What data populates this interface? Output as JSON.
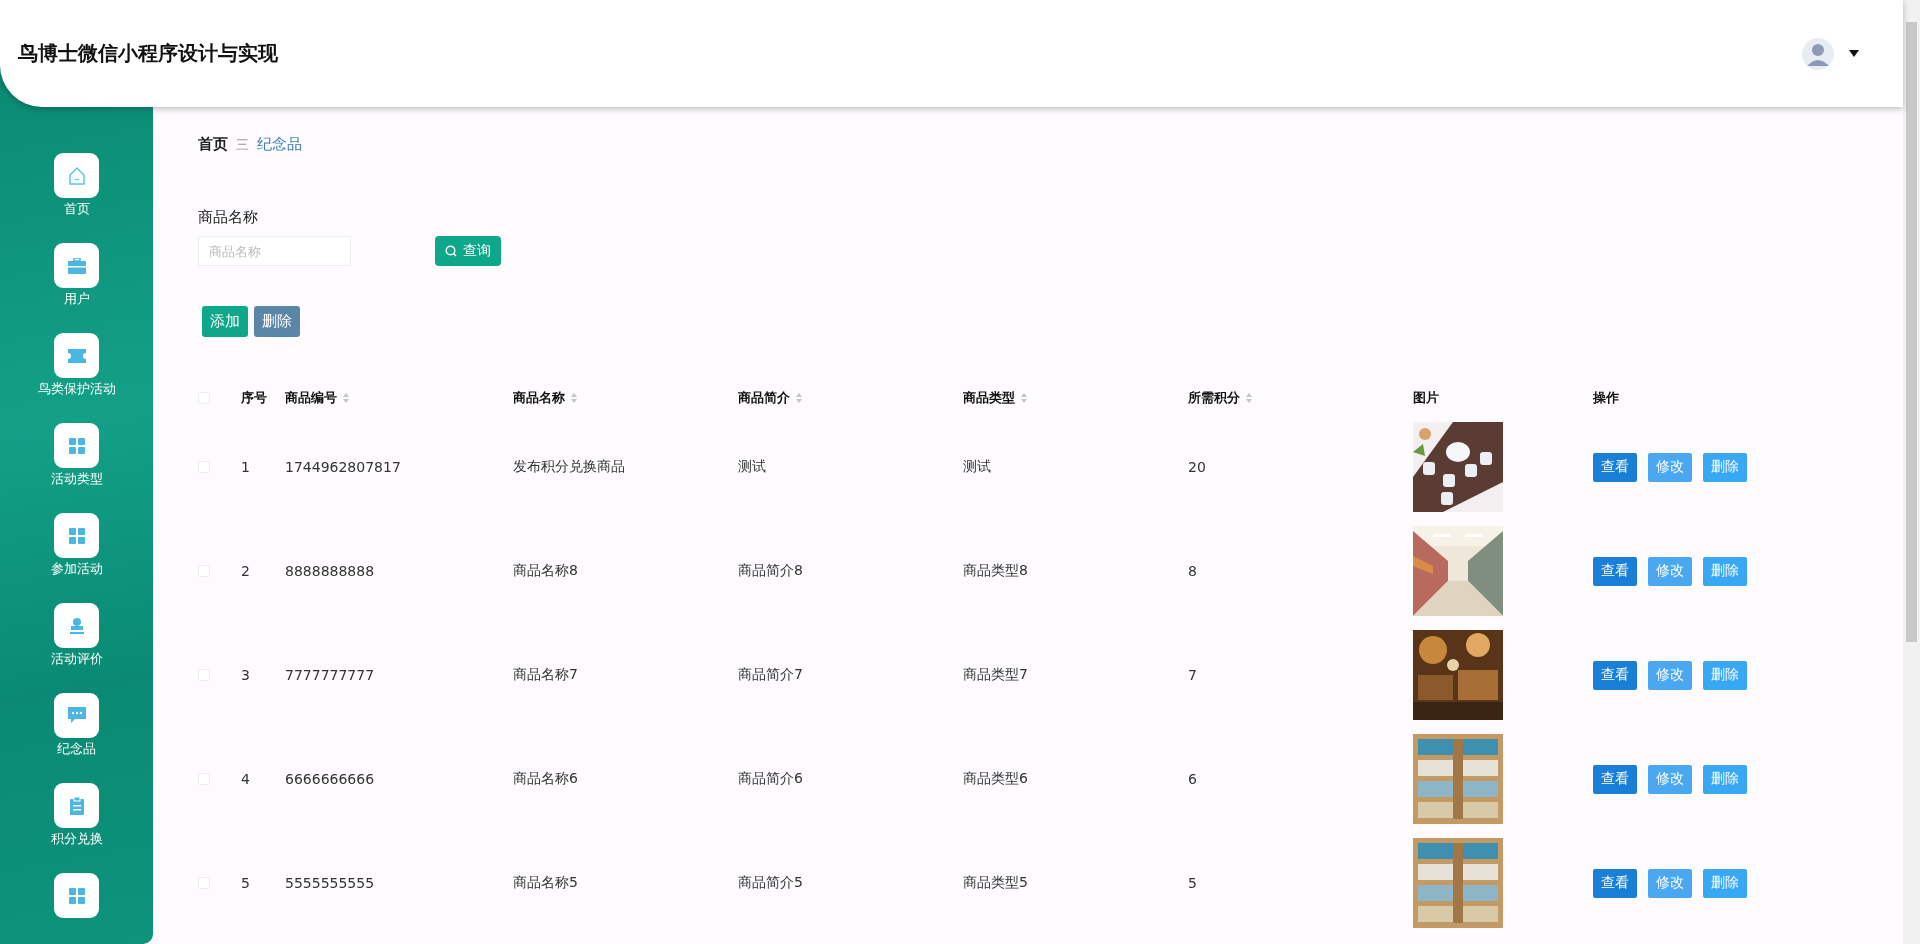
{
  "header": {
    "title": "鸟博士微信小程序设计与实现"
  },
  "sidebar": {
    "items": [
      {
        "label": "首页",
        "kind": "home"
      },
      {
        "label": "用户",
        "kind": "briefcase"
      },
      {
        "label": "鸟类保护活动",
        "kind": "ticket"
      },
      {
        "label": "活动类型",
        "kind": "grid"
      },
      {
        "label": "参加活动",
        "kind": "grid"
      },
      {
        "label": "活动评价",
        "kind": "stamp"
      },
      {
        "label": "纪念品",
        "kind": "chat"
      },
      {
        "label": "积分兑换",
        "kind": "clipboard"
      },
      {
        "kind": "grid"
      }
    ]
  },
  "breadcrumb": {
    "items": [
      "首页",
      "纪念品"
    ],
    "separator": "三"
  },
  "search": {
    "label": "商品名称",
    "placeholder": "商品名称",
    "button": "查询"
  },
  "actions": [
    {
      "label": "添加",
      "kind": "add"
    },
    {
      "label": "删除",
      "kind": "delete"
    }
  ],
  "table": {
    "header_checked": false,
    "columns": [
      {
        "label": "序号",
        "sortable": false
      },
      {
        "label": "商品编号",
        "sortable": true
      },
      {
        "label": "商品名称",
        "sortable": true
      },
      {
        "label": "商品简介",
        "sortable": true
      },
      {
        "label": "商品类型",
        "sortable": true
      },
      {
        "label": "所需积分",
        "sortable": true
      },
      {
        "label": "图片",
        "sortable": false
      },
      {
        "label": "操作",
        "sortable": false
      }
    ],
    "rows": [
      {
        "checked": false,
        "cells": [
          "1",
          "1744962807817",
          "发布积分兑换商品",
          "测试",
          "测试",
          "20"
        ],
        "kind": "picture",
        "buttons": [
          {
            "label": "查看",
            "kind": "view"
          },
          {
            "label": "修改",
            "kind": "edit"
          },
          {
            "label": "删除",
            "kind": "delete"
          }
        ]
      },
      {
        "checked": false,
        "cells": [
          "2",
          "8888888888",
          "商品名称8",
          "商品简介8",
          "商品类型8",
          "8"
        ],
        "kind": "picture",
        "buttons": [
          {
            "label": "查看",
            "kind": "view"
          },
          {
            "label": "修改",
            "kind": "edit"
          },
          {
            "label": "删除",
            "kind": "delete"
          }
        ]
      },
      {
        "checked": false,
        "cells": [
          "3",
          "7777777777",
          "商品名称7",
          "商品简介7",
          "商品类型7",
          "7"
        ],
        "kind": "picture",
        "buttons": [
          {
            "label": "查看",
            "kind": "view"
          },
          {
            "label": "修改",
            "kind": "edit"
          },
          {
            "label": "删除",
            "kind": "delete"
          }
        ]
      },
      {
        "checked": false,
        "cells": [
          "4",
          "6666666666",
          "商品名称6",
          "商品简介6",
          "商品类型6",
          "6"
        ],
        "kind": "picture",
        "buttons": [
          {
            "label": "查看",
            "kind": "view"
          },
          {
            "label": "修改",
            "kind": "edit"
          },
          {
            "label": "删除",
            "kind": "delete"
          }
        ]
      },
      {
        "checked": false,
        "cells": [
          "5",
          "5555555555",
          "商品名称5",
          "商品简介5",
          "商品类型5",
          "5"
        ],
        "kind": "picture",
        "buttons": [
          {
            "label": "查看",
            "kind": "view"
          },
          {
            "label": "修改",
            "kind": "edit"
          },
          {
            "label": "删除",
            "kind": "delete"
          }
        ]
      }
    ]
  }
}
